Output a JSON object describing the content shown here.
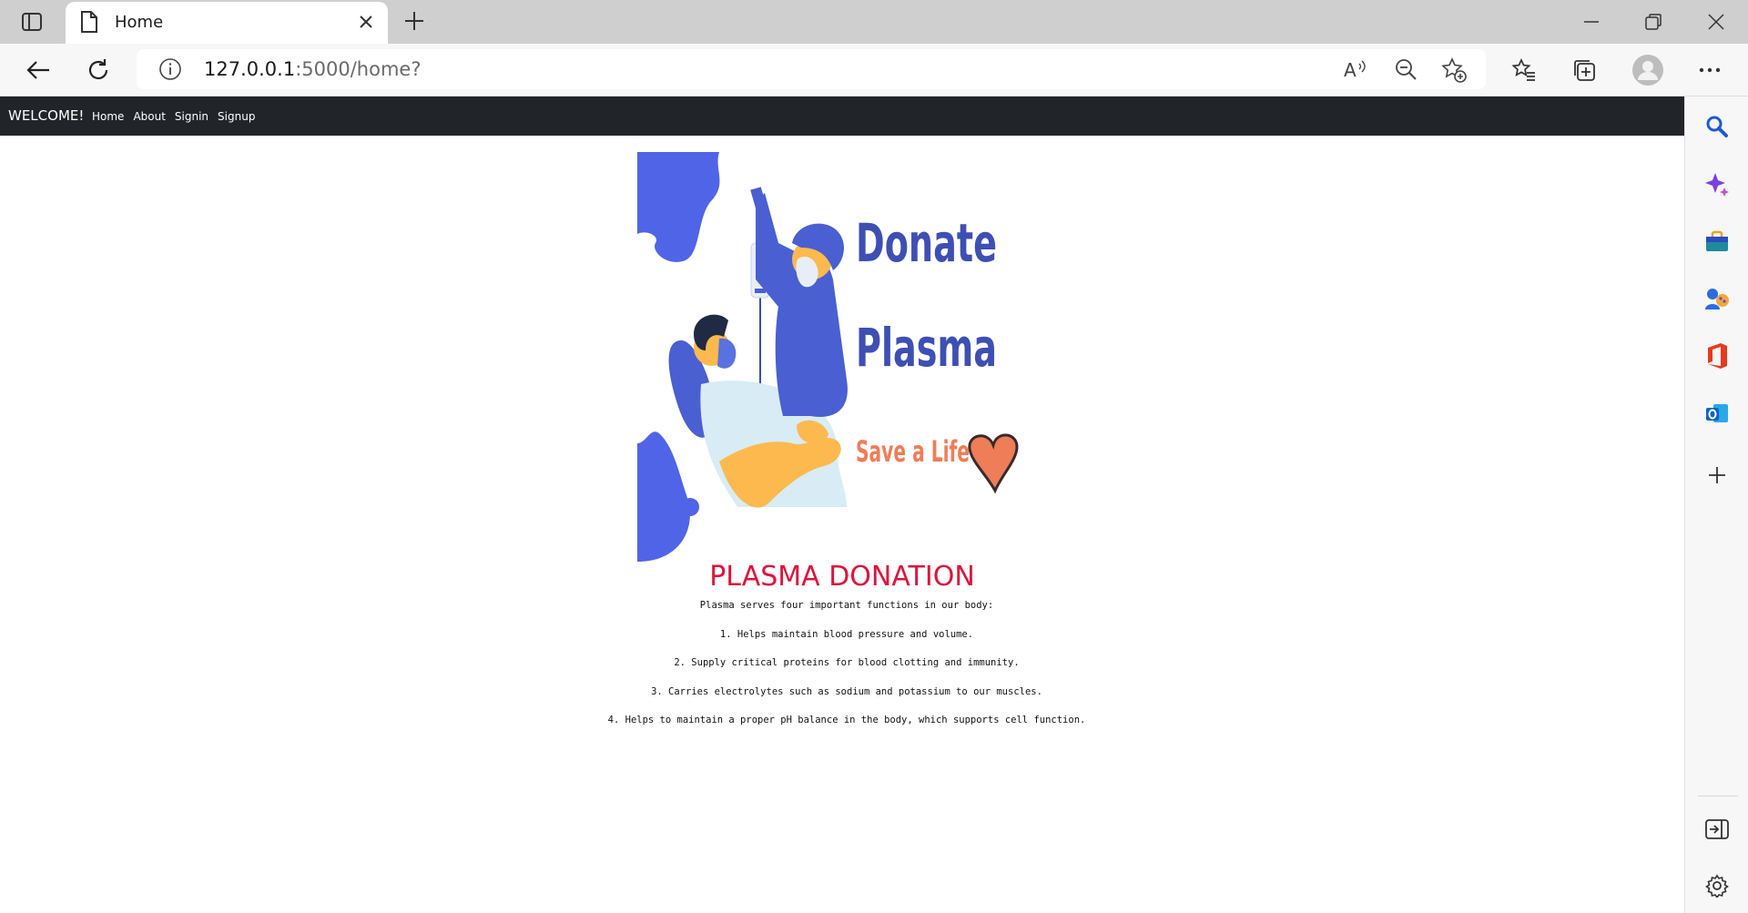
{
  "browser": {
    "tab_title": "Home",
    "url_host": "127.0.0.1",
    "url_path": ":5000/home?"
  },
  "navbar": {
    "brand": "WELCOME!",
    "links": [
      "Home",
      "About",
      "Signin",
      "Signup"
    ]
  },
  "hero": {
    "line1": "Donate",
    "line2": "Plasma",
    "line3": "Save a Life"
  },
  "content": {
    "heading": "PLASMA DONATION",
    "intro": "Plasma serves four important functions in our body:",
    "points": [
      "1. Helps maintain blood pressure and volume.",
      "2. Supply critical proteins for blood clotting and immunity.",
      "3. Carries electrolytes such as sodium and potassium to our muscles.",
      "4. Helps to maintain a proper pH balance in the body, which supports cell function."
    ]
  },
  "colors": {
    "navbar_bg": "#212529",
    "heading": "#dc143c",
    "hero_blue": "#4a5fd1",
    "hero_orange": "#ef7d58"
  },
  "icons": {
    "sidebar": [
      "search-icon",
      "copilot-icon",
      "shopping-icon",
      "games-icon",
      "office-icon",
      "outlook-icon",
      "add-icon",
      "hide-sidebar-icon",
      "settings-icon"
    ]
  }
}
